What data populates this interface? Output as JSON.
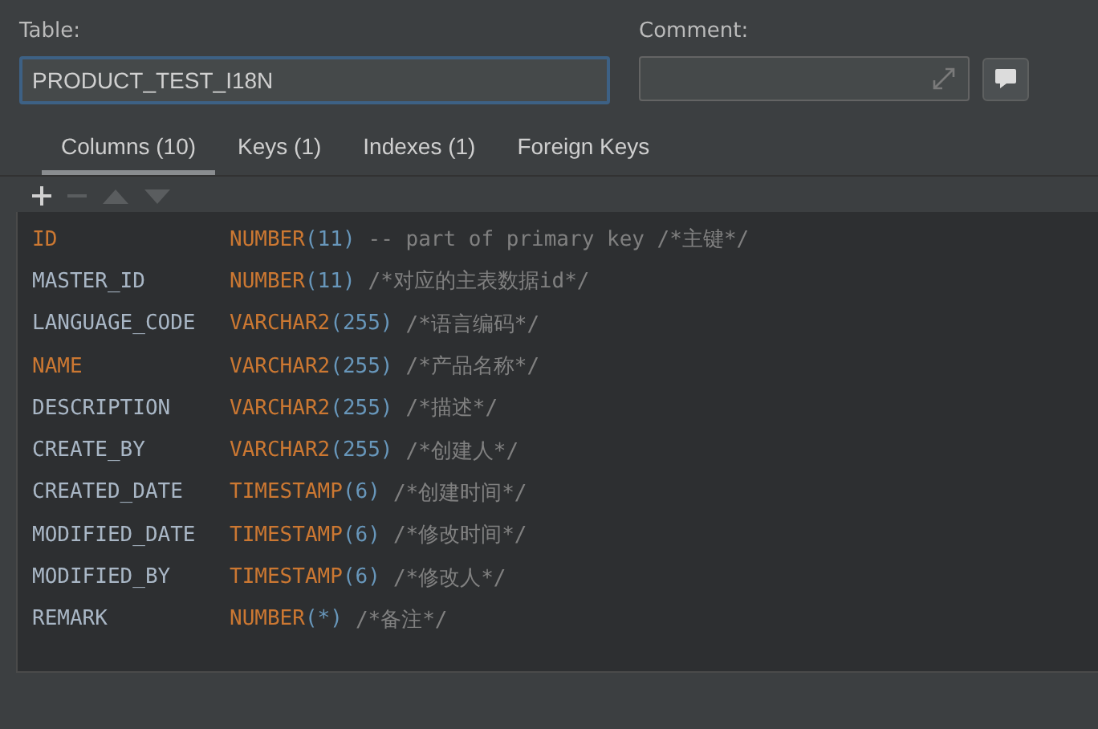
{
  "table_label": "Table:",
  "table_name": "PRODUCT_TEST_I18N",
  "comment_label": "Comment:",
  "tabs": [
    {
      "label": "Columns (10)",
      "selected": true
    },
    {
      "label": "Keys (1)",
      "selected": false
    },
    {
      "label": "Indexes (1)",
      "selected": false
    },
    {
      "label": "Foreign Keys",
      "selected": false
    }
  ],
  "toolbar": [
    {
      "kind": "add",
      "disabled": false
    },
    {
      "kind": "remove",
      "disabled": true
    },
    {
      "kind": "up",
      "disabled": true
    },
    {
      "kind": "down",
      "disabled": true
    }
  ],
  "columns": [
    {
      "name": "ID",
      "key": true,
      "type": "NUMBER",
      "size": "(11)",
      "comment": "-- part of primary key /*主键*/"
    },
    {
      "name": "MASTER_ID",
      "key": false,
      "type": "NUMBER",
      "size": "(11)",
      "comment": "/*对应的主表数据id*/"
    },
    {
      "name": "LANGUAGE_CODE",
      "key": false,
      "type": "VARCHAR2",
      "size": "(255)",
      "comment": "/*语言编码*/"
    },
    {
      "name": "NAME",
      "key": true,
      "type": "VARCHAR2",
      "size": "(255)",
      "comment": "/*产品名称*/"
    },
    {
      "name": "DESCRIPTION",
      "key": false,
      "type": "VARCHAR2",
      "size": "(255)",
      "comment": "/*描述*/"
    },
    {
      "name": "CREATE_BY",
      "key": false,
      "type": "VARCHAR2",
      "size": "(255)",
      "comment": "/*创建人*/"
    },
    {
      "name": "CREATED_DATE",
      "key": false,
      "type": "TIMESTAMP",
      "size": "(6)",
      "comment": "/*创建时间*/"
    },
    {
      "name": "MODIFIED_DATE",
      "key": false,
      "type": "TIMESTAMP",
      "size": "(6)",
      "comment": "/*修改时间*/"
    },
    {
      "name": "MODIFIED_BY",
      "key": false,
      "type": "TIMESTAMP",
      "size": "(6)",
      "comment": "/*修改人*/"
    },
    {
      "name": "REMARK",
      "key": false,
      "type": "NUMBER",
      "size": "(*)",
      "comment": "/*备注*/"
    }
  ]
}
